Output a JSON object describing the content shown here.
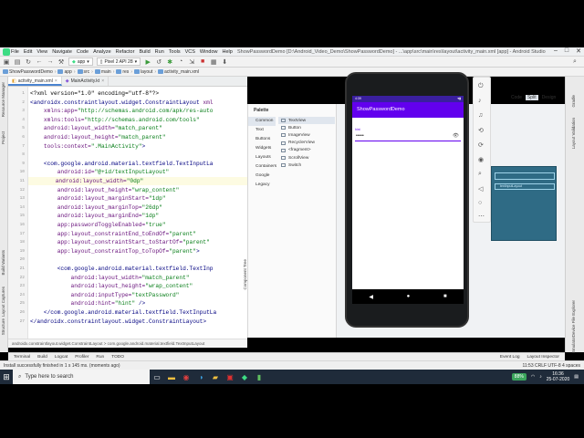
{
  "window": {
    "title": "ShowPasswordDemo [D:\\Android_Video_Demo\\ShowPasswordDemo] - ...\\app\\src\\main\\res\\layout\\activity_main.xml [app] - Android Studio",
    "controls": [
      "–",
      "□",
      "✕"
    ]
  },
  "menu": [
    "File",
    "Edit",
    "View",
    "Navigate",
    "Code",
    "Analyze",
    "Refactor",
    "Build",
    "Run",
    "Tools",
    "VCS",
    "Window",
    "Help"
  ],
  "toolbar": {
    "module": "app",
    "device": "Pixel 2 API 28"
  },
  "breadcrumbs": [
    "ShowPasswordDemo",
    "app",
    "src",
    "main",
    "res",
    "layout",
    "activity_main.xml"
  ],
  "file_tabs": [
    {
      "label": "activity_main.xml",
      "active": true
    },
    {
      "label": "MainActivity.kt",
      "active": false
    }
  ],
  "code_lines": [
    [
      {
        "t": "<?xml version=\"1.0\" encoding=\"utf-8\"?>",
        "c": "plain"
      }
    ],
    [
      {
        "t": "<androidx.constraintlayout.widget.ConstraintLayout ",
        "c": "tag"
      },
      {
        "t": "xml",
        "c": "attr"
      }
    ],
    [
      {
        "t": "    xmlns:app=",
        "c": "attr"
      },
      {
        "t": "\"http://schemas.android.com/apk/res-auto",
        "c": "val"
      }
    ],
    [
      {
        "t": "    xmlns:tools=",
        "c": "attr"
      },
      {
        "t": "\"http://schemas.android.com/tools\"",
        "c": "val"
      }
    ],
    [
      {
        "t": "    android:layout_width=",
        "c": "attr"
      },
      {
        "t": "\"match_parent\"",
        "c": "val"
      }
    ],
    [
      {
        "t": "    android:layout_height=",
        "c": "attr"
      },
      {
        "t": "\"match_parent\"",
        "c": "val"
      }
    ],
    [
      {
        "t": "    tools:context=",
        "c": "attr"
      },
      {
        "t": "\".MainActivity\"",
        "c": "val"
      },
      {
        "t": ">",
        "c": "tag"
      }
    ],
    [
      {
        "t": "",
        "c": "plain"
      }
    ],
    [
      {
        "t": "    <com.google.android.material.textfield.TextInputLa",
        "c": "tag"
      }
    ],
    [
      {
        "t": "        android:id=",
        "c": "attr"
      },
      {
        "t": "\"@+id/textInputLayout\"",
        "c": "val"
      }
    ],
    [
      {
        "t": "        android:layout_width=",
        "c": "attr"
      },
      {
        "t": "\"0dp\"",
        "c": "val"
      }
    ],
    [
      {
        "t": "        android:layout_height=",
        "c": "attr"
      },
      {
        "t": "\"wrap_content\"",
        "c": "val"
      }
    ],
    [
      {
        "t": "        android:layout_marginStart=",
        "c": "attr"
      },
      {
        "t": "\"1dp\"",
        "c": "val"
      }
    ],
    [
      {
        "t": "        android:layout_marginTop=",
        "c": "attr"
      },
      {
        "t": "\"26dp\"",
        "c": "val"
      }
    ],
    [
      {
        "t": "        android:layout_marginEnd=",
        "c": "attr"
      },
      {
        "t": "\"1dp\"",
        "c": "val"
      }
    ],
    [
      {
        "t": "        app:passwordToggleEnabled=",
        "c": "attr"
      },
      {
        "t": "\"true\"",
        "c": "val"
      }
    ],
    [
      {
        "t": "        app:layout_constraintEnd_toEndOf=",
        "c": "attr"
      },
      {
        "t": "\"parent\"",
        "c": "val"
      }
    ],
    [
      {
        "t": "        app:layout_constraintStart_toStartOf=",
        "c": "attr"
      },
      {
        "t": "\"parent\"",
        "c": "val"
      }
    ],
    [
      {
        "t": "        app:layout_constraintTop_toTopOf=",
        "c": "attr"
      },
      {
        "t": "\"parent\"",
        "c": "val"
      },
      {
        "t": ">",
        "c": "tag"
      }
    ],
    [
      {
        "t": "",
        "c": "plain"
      }
    ],
    [
      {
        "t": "        <com.google.android.material.textfield.TextInp",
        "c": "tag"
      }
    ],
    [
      {
        "t": "            android:layout_width=",
        "c": "attr"
      },
      {
        "t": "\"match_parent\"",
        "c": "val"
      }
    ],
    [
      {
        "t": "            android:layout_height=",
        "c": "attr"
      },
      {
        "t": "\"wrap_content\"",
        "c": "val"
      }
    ],
    [
      {
        "t": "            android:inputType=",
        "c": "attr"
      },
      {
        "t": "\"textPassword\"",
        "c": "val"
      }
    ],
    [
      {
        "t": "            android:hint=",
        "c": "attr"
      },
      {
        "t": "\"hint\"",
        "c": "val"
      },
      {
        "t": " />",
        "c": "tag"
      }
    ],
    [
      {
        "t": "    </com.google.android.material.textfield.TextInputLa",
        "c": "tag"
      }
    ],
    [
      {
        "t": "</androidx.constraintlayout.widget.ConstraintLayout>",
        "c": "tag"
      }
    ]
  ],
  "editor_footer": "androidx.constraintlayout.widget.ConstraintLayout  >  com.google.android.material.textfield.TextInputLayout",
  "palette": {
    "title": "Palette",
    "categories": [
      "Common",
      "Text",
      "Buttons",
      "Widgets",
      "Layouts",
      "Containers",
      "Google",
      "Legacy"
    ],
    "items": [
      "TextView",
      "Button",
      "ImageView",
      "RecyclerView",
      "<fragment>",
      "ScrollView",
      "Switch"
    ]
  },
  "design_tabs": [
    "Code",
    "Split",
    "Design"
  ],
  "left_tool_labels": [
    "Resource Manager",
    "Project",
    "Build Variants",
    "Layout Captures",
    "Structure",
    "Favorites"
  ],
  "right_tool_labels": [
    "Gradle",
    "Layout Validation",
    "Device File Explorer",
    "Emulator"
  ],
  "component_tree_label": "Component Tree",
  "emulator": {
    "status_time": "4:39",
    "app_title": "ShowPasswordDemo",
    "field_hint": "hint",
    "field_value": "•••••",
    "eye_icon": "👁",
    "blueprint_label": "textInputLayout"
  },
  "bottom_tabs": [
    "Terminal",
    "Build",
    "Logcat",
    "Profiler",
    "Run",
    "TODO",
    "Event Log",
    "Layout Inspector"
  ],
  "status": {
    "left": "Install successfully finished in 1 s 145 ms. (moments ago)",
    "right": "11:53   CRLF   UTF-8   4 spaces"
  },
  "taskbar": {
    "search_placeholder": "Type here to search",
    "battery": "88%",
    "time": "16:36",
    "date": "25-07-2020",
    "apps": [
      "chrome-icon",
      "edge-icon",
      "folder-icon",
      "pdf-icon",
      "android-studio-icon",
      "green-app-icon"
    ]
  }
}
